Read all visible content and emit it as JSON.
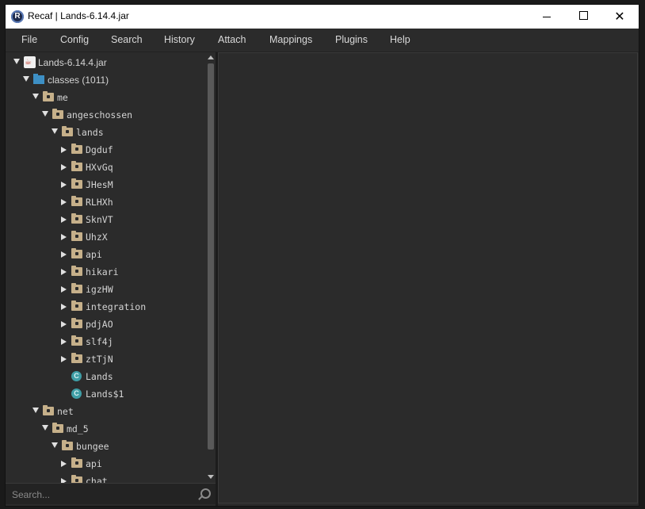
{
  "window": {
    "title": "Recaf | Lands-6.14.4.jar",
    "minimize_label": "",
    "maximize_label": "",
    "close_label": "✕"
  },
  "menu": [
    "File",
    "Config",
    "Search",
    "History",
    "Attach",
    "Mappings",
    "Plugins",
    "Help"
  ],
  "tree": [
    {
      "label": "Lands-6.14.4.jar",
      "depth": 0,
      "arrow": "down",
      "icon": "jar",
      "mono": false
    },
    {
      "label": "classes (1011)",
      "depth": 1,
      "arrow": "down",
      "icon": "dir",
      "mono": false
    },
    {
      "label": "me",
      "depth": 2,
      "arrow": "down",
      "icon": "pkg",
      "mono": true
    },
    {
      "label": "angeschossen",
      "depth": 3,
      "arrow": "down",
      "icon": "pkg",
      "mono": true
    },
    {
      "label": "lands",
      "depth": 4,
      "arrow": "down",
      "icon": "pkg",
      "mono": true
    },
    {
      "label": "Dgduf",
      "depth": 5,
      "arrow": "right",
      "icon": "pkg",
      "mono": true
    },
    {
      "label": "HXvGq",
      "depth": 5,
      "arrow": "right",
      "icon": "pkg",
      "mono": true
    },
    {
      "label": "JHesM",
      "depth": 5,
      "arrow": "right",
      "icon": "pkg",
      "mono": true
    },
    {
      "label": "RLHXh",
      "depth": 5,
      "arrow": "right",
      "icon": "pkg",
      "mono": true
    },
    {
      "label": "SknVT",
      "depth": 5,
      "arrow": "right",
      "icon": "pkg",
      "mono": true
    },
    {
      "label": "UhzX",
      "depth": 5,
      "arrow": "right",
      "icon": "pkg",
      "mono": true
    },
    {
      "label": "api",
      "depth": 5,
      "arrow": "right",
      "icon": "pkg",
      "mono": true
    },
    {
      "label": "hikari",
      "depth": 5,
      "arrow": "right",
      "icon": "pkg",
      "mono": true
    },
    {
      "label": "igzHW",
      "depth": 5,
      "arrow": "right",
      "icon": "pkg",
      "mono": true
    },
    {
      "label": "integration",
      "depth": 5,
      "arrow": "right",
      "icon": "pkg",
      "mono": true
    },
    {
      "label": "pdjAO",
      "depth": 5,
      "arrow": "right",
      "icon": "pkg",
      "mono": true
    },
    {
      "label": "slf4j",
      "depth": 5,
      "arrow": "right",
      "icon": "pkg",
      "mono": true
    },
    {
      "label": "ztTjN",
      "depth": 5,
      "arrow": "right",
      "icon": "pkg",
      "mono": true
    },
    {
      "label": "Lands",
      "depth": 5,
      "arrow": "none",
      "icon": "cls",
      "mono": true
    },
    {
      "label": "Lands$1",
      "depth": 5,
      "arrow": "none",
      "icon": "cls",
      "mono": true
    },
    {
      "label": "net",
      "depth": 2,
      "arrow": "down",
      "icon": "pkg",
      "mono": true
    },
    {
      "label": "md_5",
      "depth": 3,
      "arrow": "down",
      "icon": "pkg",
      "mono": true
    },
    {
      "label": "bungee",
      "depth": 4,
      "arrow": "down",
      "icon": "pkg",
      "mono": true
    },
    {
      "label": "api",
      "depth": 5,
      "arrow": "right",
      "icon": "pkg",
      "mono": true
    },
    {
      "label": "chat",
      "depth": 5,
      "arrow": "right",
      "icon": "pkg",
      "mono": true
    }
  ],
  "icons": {
    "jar": "java-jar-icon",
    "dir": "folder-icon",
    "pkg": "package-icon",
    "cls": "class-icon"
  },
  "search": {
    "placeholder": "Search..."
  },
  "colors": {
    "package": "#c6b08a",
    "folder": "#3d8fc4",
    "class": "#3f9ea6",
    "background": "#2b2b2b"
  }
}
